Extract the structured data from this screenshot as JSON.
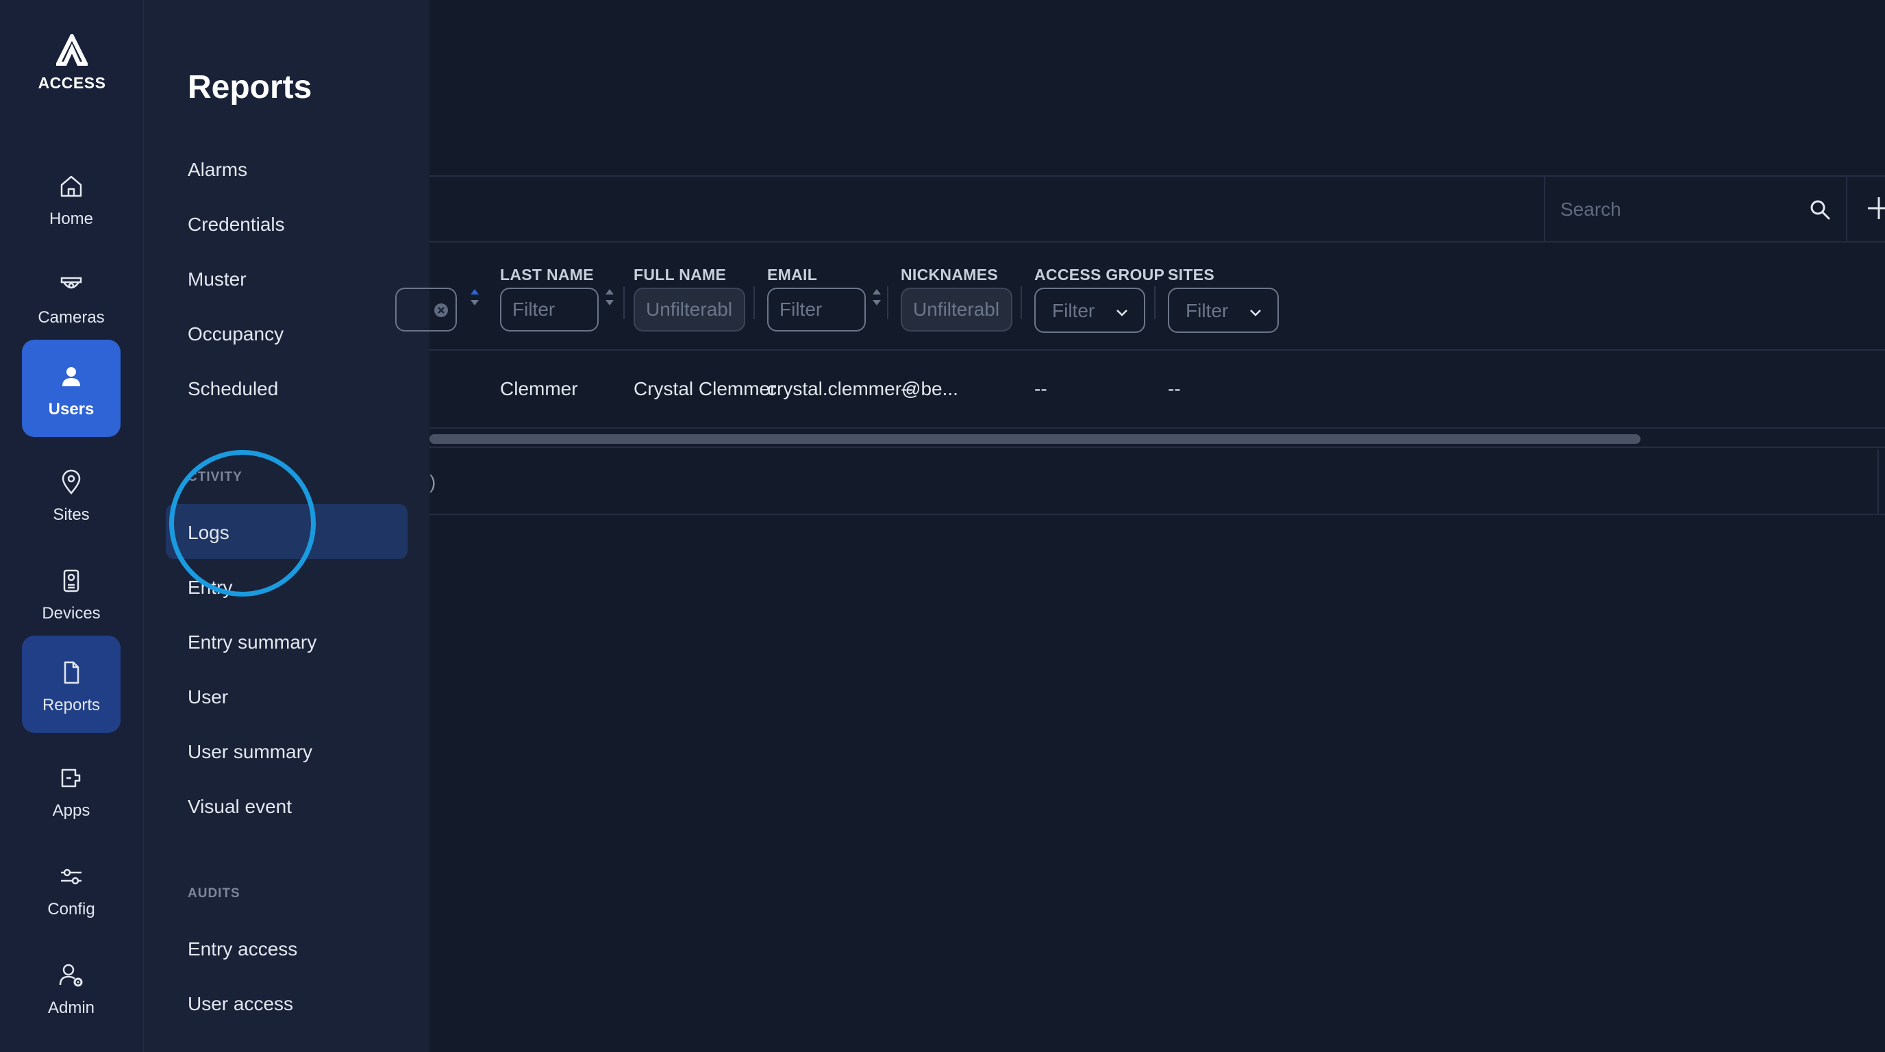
{
  "brand": {
    "name": "ACCESS"
  },
  "nav": {
    "home": "Home",
    "cameras": "Cameras",
    "users": "Users",
    "sites": "Sites",
    "devices": "Devices",
    "reports": "Reports",
    "apps": "Apps",
    "config": "Config",
    "admin": "Admin"
  },
  "reports_panel": {
    "title": "Reports",
    "top_items": [
      "Alarms",
      "Credentials",
      "Muster",
      "Occupancy",
      "Scheduled"
    ],
    "activity_label": "CTIVITY",
    "activity_items": [
      "Logs",
      "Entry",
      "Entry summary",
      "User",
      "User summary",
      "Visual event"
    ],
    "audits_label": "AUDITS",
    "audits_items": [
      "Entry access",
      "User access"
    ]
  },
  "search": {
    "placeholder": "Search"
  },
  "table": {
    "columns": {
      "last_name": "LAST NAME",
      "full_name": "FULL NAME",
      "email": "EMAIL",
      "nicknames": "NICKNAMES",
      "access_group": "ACCESS GROUP",
      "sites": "SITES"
    },
    "filters": {
      "filter": "Filter",
      "unfilterable": "Unfilterable"
    },
    "row": {
      "last_name": "Clemmer",
      "full_name": "Crystal Clemmer",
      "email": "crystal.clemmer@be...",
      "nicknames": "--",
      "access_group": "--",
      "sites": "--"
    },
    "footer_text": ")"
  },
  "colors": {
    "accent": "#2f64d6",
    "highlight_ring": "#1a9be0",
    "background": "#131a29",
    "panel": "#1a2238"
  }
}
